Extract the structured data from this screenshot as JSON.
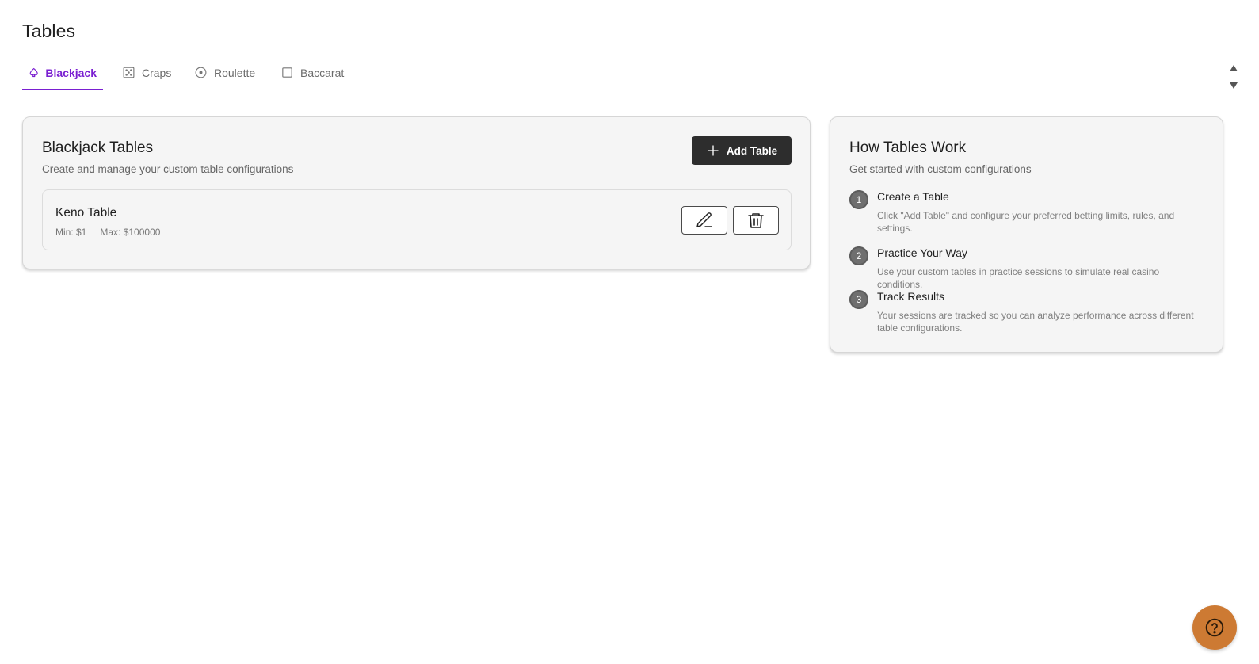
{
  "page": {
    "title": "Tables"
  },
  "tabs": [
    {
      "label": "Blackjack",
      "icon": "spade-icon",
      "active": true
    },
    {
      "label": "Craps",
      "icon": "dice-icon",
      "active": false
    },
    {
      "label": "Roulette",
      "icon": "roulette-icon",
      "active": false
    },
    {
      "label": "Baccarat",
      "icon": "card-icon",
      "active": false
    }
  ],
  "tables_card": {
    "title": "Blackjack Tables",
    "subtitle": "Create and manage your custom table configurations",
    "add_button_label": "Add Table",
    "items": [
      {
        "name": "Keno Table",
        "min": "Min: $1",
        "max": "Max: $100000"
      }
    ]
  },
  "how_it_works": {
    "title": "How Tables Work",
    "subtitle": "Get started with custom configurations",
    "steps": [
      {
        "number": "1",
        "title": "Create a Table",
        "description": "Click \"Add Table\" and configure your preferred betting limits, rules, and settings."
      },
      {
        "number": "2",
        "title": "Practice Your Way",
        "description": "Use your custom tables in practice sessions to simulate real casino conditions."
      },
      {
        "number": "3",
        "title": "Track Results",
        "description": "Your sessions are tracked so you can analyze performance across different table configurations."
      }
    ]
  },
  "colors": {
    "accent": "#7a1fd1",
    "primary_button": "#2d2d2d",
    "help_button": "#cd7a33",
    "card_background": "#f5f5f5"
  }
}
